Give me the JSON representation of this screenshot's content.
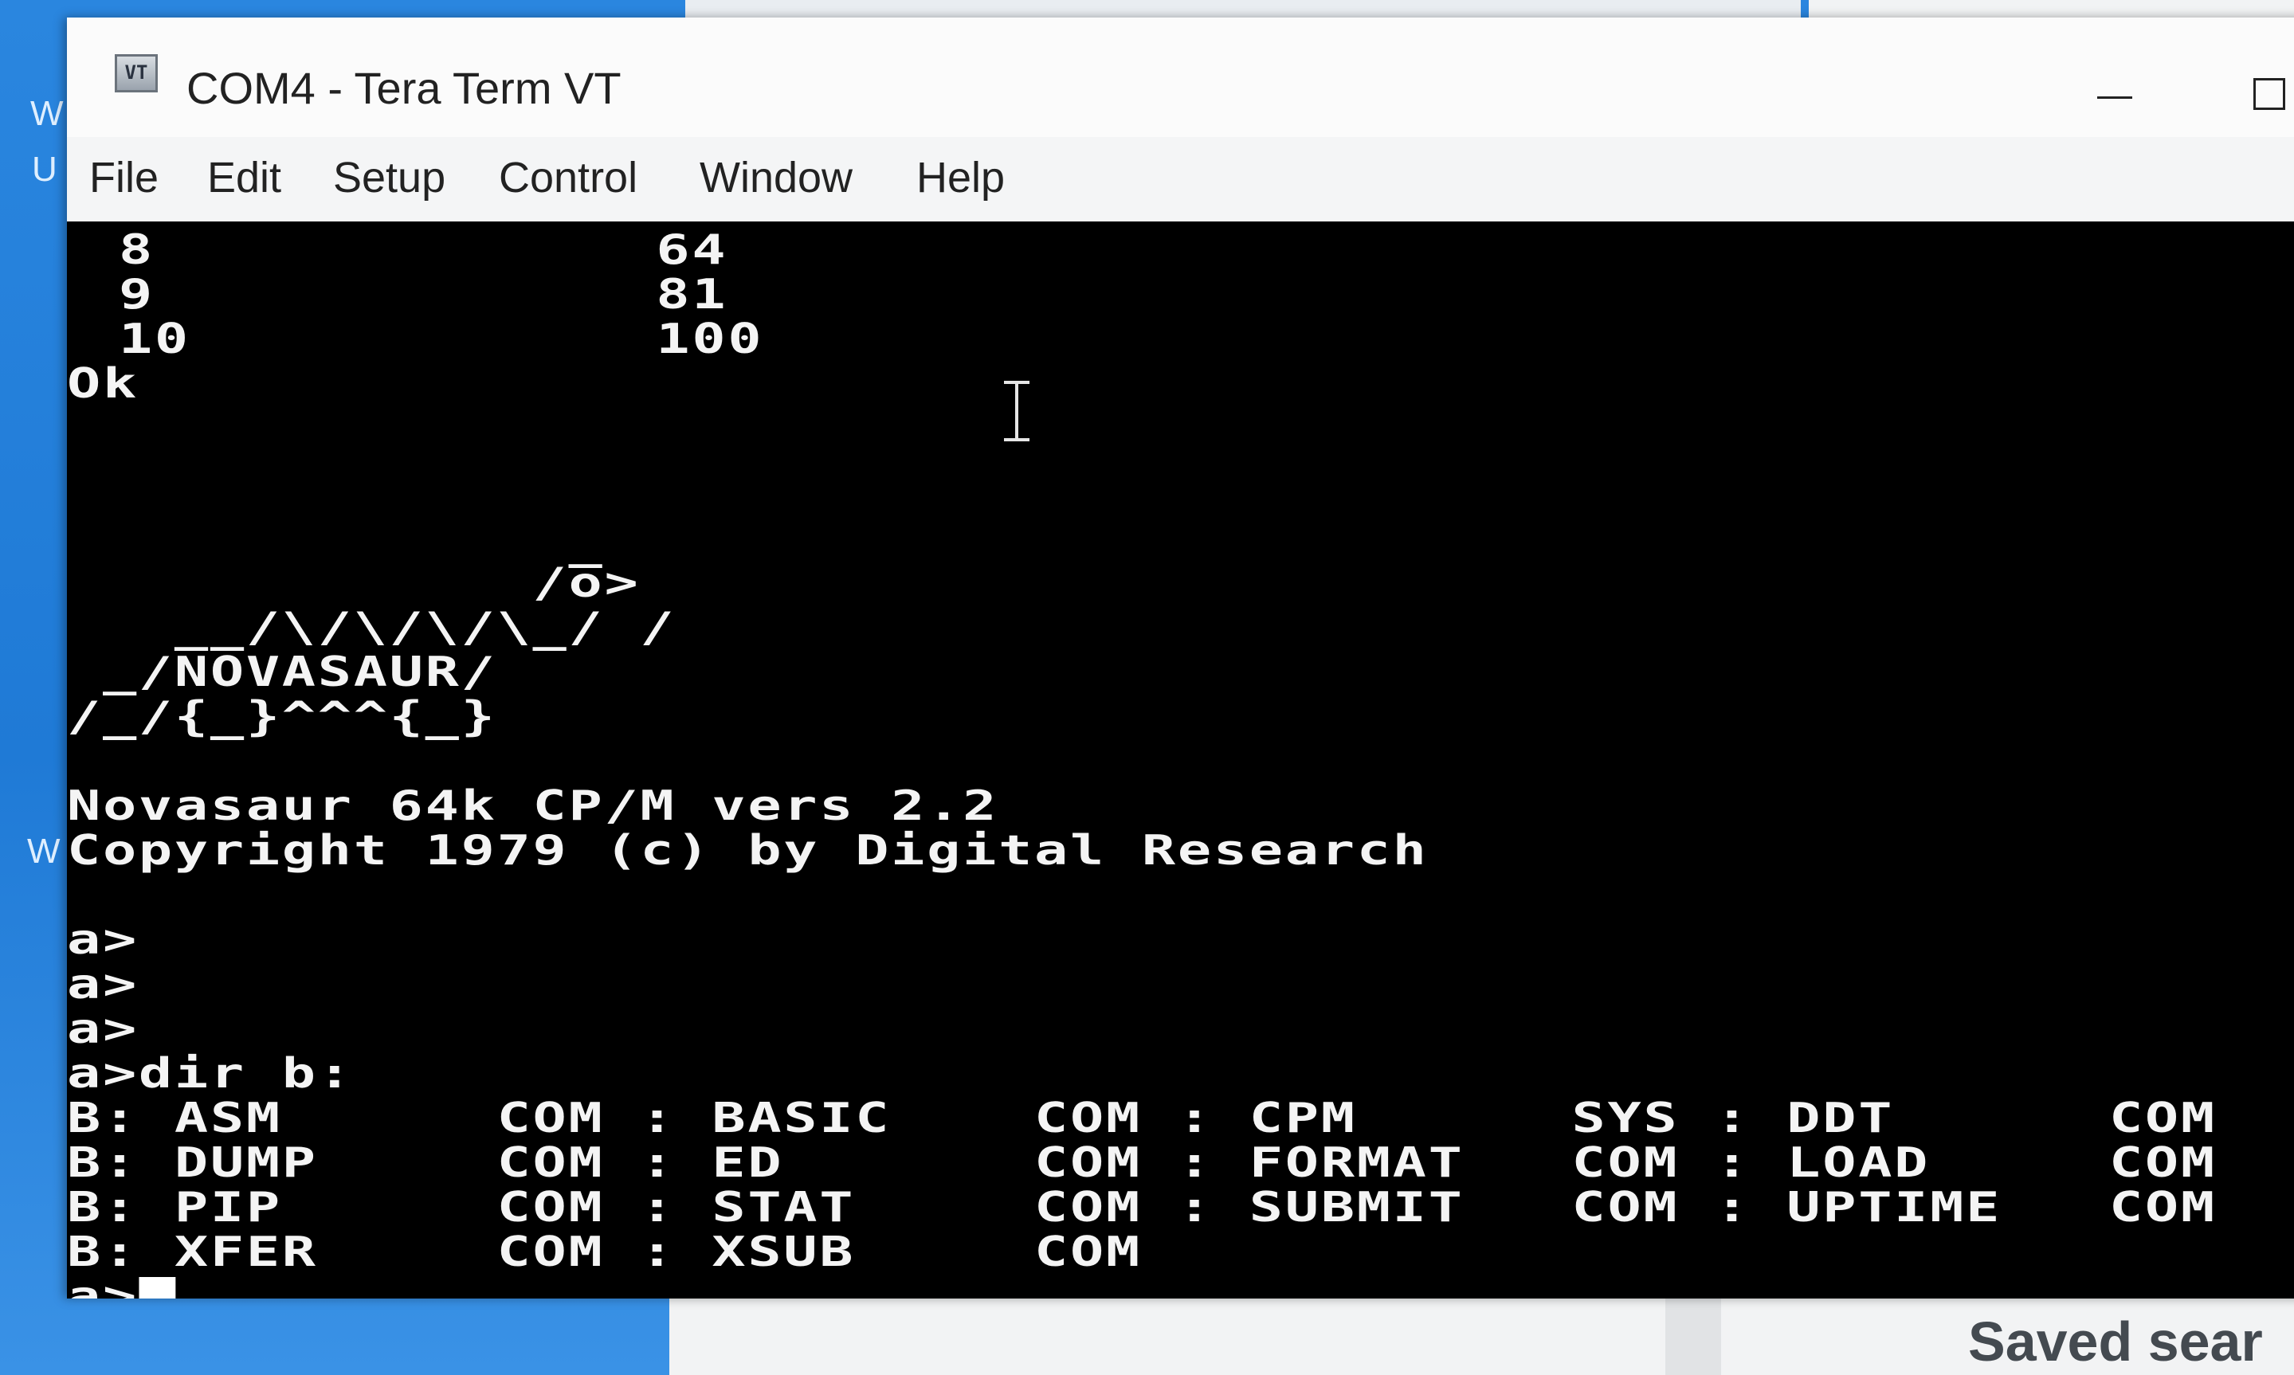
{
  "window": {
    "title": "COM4 - Tera Term VT",
    "icon_label": "VT"
  },
  "menu": {
    "items": [
      "File",
      "Edit",
      "Setup",
      "Control",
      "Window",
      "Help"
    ]
  },
  "terminal": {
    "lines": [
      " 8              64",
      " 9              81",
      " 10             100",
      "Ok",
      "",
      "",
      "",
      "              _",
      "             /o>",
      "   __/\\/\\/\\/\\_/ /",
      " _/NOVASAUR/",
      "/_/{_}^^^{_}",
      "",
      "Novasaur 64k CP/M vers 2.2",
      "Copyright 1979 (c) by Digital Research",
      "",
      "a>",
      "a>",
      "a>",
      "a>dir b:",
      "B: ASM      COM : BASIC    COM : CPM      SYS : DDT      COM",
      "B: DUMP     COM : ED       COM : FORMAT   COM : LOAD     COM",
      "B: PIP      COM : STAT     COM : SUBMIT   COM : UPTIME   COM",
      "B: XFER     COM : XSUB     COM",
      "a>"
    ]
  },
  "desktop": {
    "saved_text": "Saved sear",
    "letters": [
      "W",
      "U",
      "W"
    ]
  }
}
